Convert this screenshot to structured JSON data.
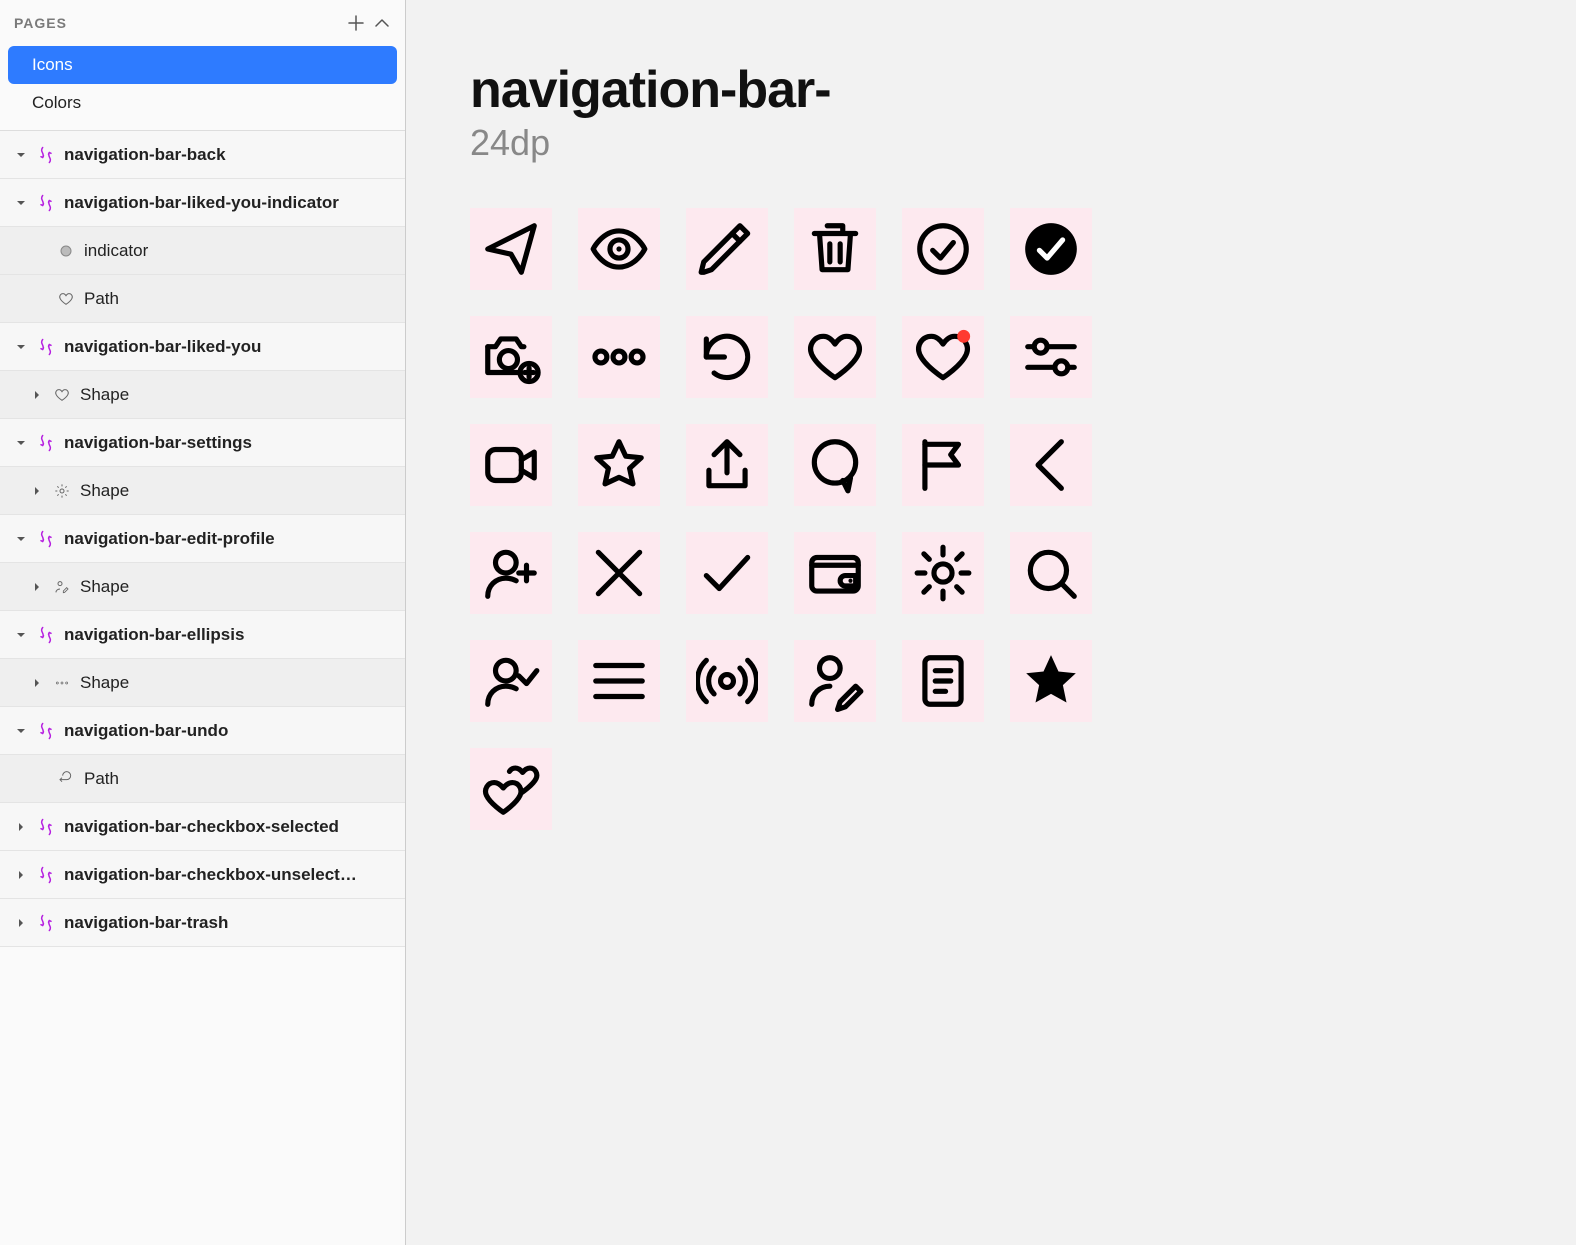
{
  "pages": {
    "header": "PAGES",
    "items": [
      {
        "label": "Icons",
        "selected": true
      },
      {
        "label": "Colors",
        "selected": false
      }
    ]
  },
  "layers": [
    {
      "label": "navigation-bar-back",
      "expanded": true,
      "children": []
    },
    {
      "label": "navigation-bar-liked-you-indicator",
      "expanded": true,
      "children": [
        {
          "label": "indicator",
          "icon": "circle"
        },
        {
          "label": "Path",
          "icon": "heart"
        }
      ]
    },
    {
      "label": "navigation-bar-liked-you",
      "expanded": true,
      "children": [
        {
          "label": "Shape",
          "icon": "heart",
          "disclosure": true
        }
      ]
    },
    {
      "label": "navigation-bar-settings",
      "expanded": true,
      "children": [
        {
          "label": "Shape",
          "icon": "gear",
          "disclosure": true
        }
      ]
    },
    {
      "label": "navigation-bar-edit-profile",
      "expanded": true,
      "children": [
        {
          "label": "Shape",
          "icon": "person-edit",
          "disclosure": true
        }
      ]
    },
    {
      "label": "navigation-bar-ellipsis",
      "expanded": true,
      "children": [
        {
          "label": "Shape",
          "icon": "ellipsis",
          "disclosure": true
        }
      ]
    },
    {
      "label": "navigation-bar-undo",
      "expanded": true,
      "children": [
        {
          "label": "Path",
          "icon": "undo"
        }
      ]
    },
    {
      "label": "navigation-bar-checkbox-selected",
      "expanded": false,
      "children": []
    },
    {
      "label": "navigation-bar-checkbox-unselect…",
      "expanded": false,
      "children": []
    },
    {
      "label": "navigation-bar-trash",
      "expanded": false,
      "children": []
    }
  ],
  "canvas": {
    "title": "navigation-bar-",
    "subtitle": "24dp",
    "icons": [
      "send-arrow",
      "eye",
      "pencil",
      "trash",
      "check-circle",
      "check-circle-filled",
      "camera-plus",
      "ellipsis",
      "undo",
      "heart",
      "heart-indicator",
      "sliders",
      "video",
      "star",
      "share",
      "chat",
      "flag",
      "chevron-left",
      "person-plus",
      "close",
      "check",
      "wallet",
      "gear",
      "search",
      "person-check",
      "menu",
      "broadcast",
      "person-edit",
      "document",
      "star-filled",
      "hearts-pair"
    ]
  },
  "colors": {
    "selection": "#2e7bff",
    "symbol_purple": "#b620e0",
    "artboard_bg": "#fde9ef",
    "indicator_red": "#ff3b30"
  }
}
